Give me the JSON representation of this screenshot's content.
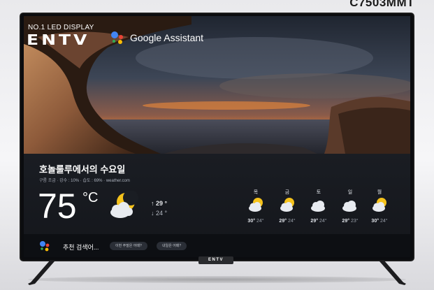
{
  "product": {
    "model": "C7503MMT"
  },
  "branding": {
    "tagline": "NO.1 LED DISPLAY",
    "logo": "ENTV",
    "assistant": "Google Assistant"
  },
  "weather": {
    "location_day": "호놀룰루에서의 수요일",
    "details": "구름 조금 · 강수 : 10% · 습도 : 69% · weather.com",
    "current_temp": "75",
    "unit": "°C",
    "current_icon": "partly-cloudy-night-icon",
    "high": "29 °",
    "low": "24 °",
    "forecast": [
      {
        "day": "목",
        "icon": "partly-cloudy-icon",
        "high": "30°",
        "low": "24°"
      },
      {
        "day": "금",
        "icon": "partly-cloudy-icon",
        "high": "29°",
        "low": "24°"
      },
      {
        "day": "토",
        "icon": "cloudy-icon",
        "high": "29°",
        "low": "24°"
      },
      {
        "day": "일",
        "icon": "cloudy-icon",
        "high": "29°",
        "low": "23°"
      },
      {
        "day": "월",
        "icon": "partly-cloudy-icon",
        "high": "30°",
        "low": "24°"
      }
    ]
  },
  "assistant_bar": {
    "label": "추천 검색어...",
    "chips": [
      "이번 주말은 어때?",
      "내일은 어때?"
    ]
  },
  "stand_logo": "ENTV",
  "colors": {
    "sun": "#f5c21b",
    "cloud": "#e8ebf0",
    "panel": "#1a1d23"
  }
}
